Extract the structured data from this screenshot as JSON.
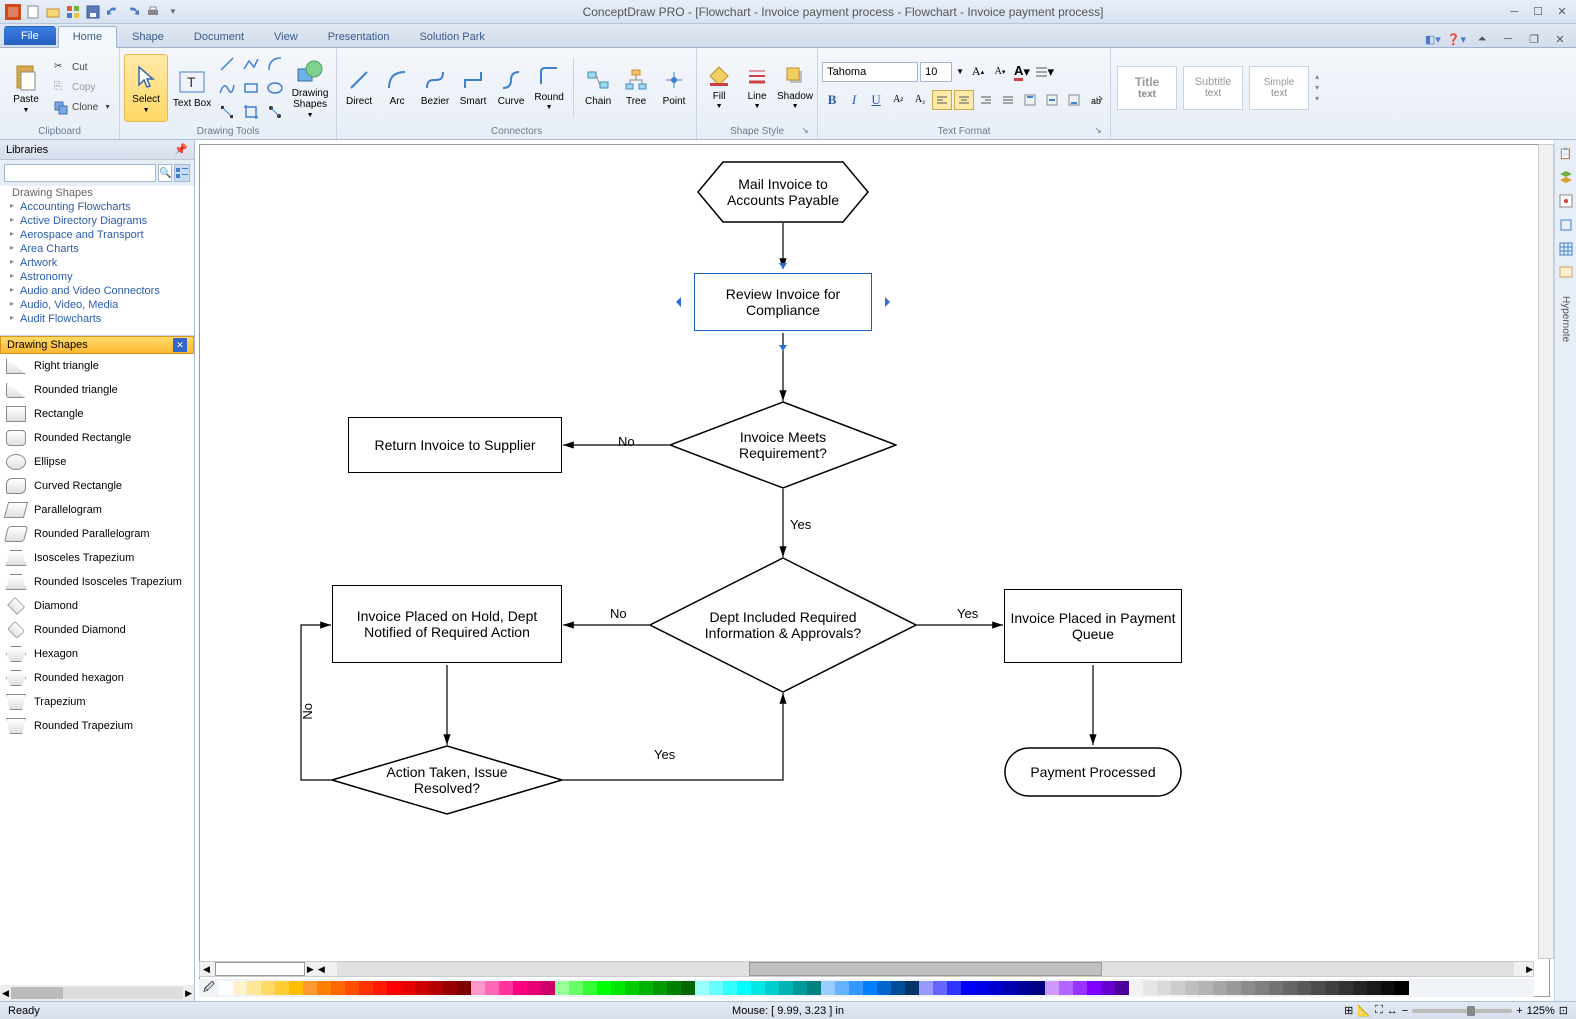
{
  "app": {
    "title": "ConceptDraw PRO - [Flowchart - Invoice payment process - Flowchart - Invoice payment process]"
  },
  "tabs": {
    "file": "File",
    "items": [
      "Home",
      "Shape",
      "Document",
      "View",
      "Presentation",
      "Solution Park"
    ],
    "active_index": 0
  },
  "ribbon": {
    "clipboard": {
      "paste": "Paste",
      "cut": "Cut",
      "copy": "Copy",
      "clone": "Clone",
      "label": "Clipboard"
    },
    "drawing_tools": {
      "select": "Select",
      "textbox": "Text Box",
      "drawing_shapes": "Drawing Shapes",
      "label": "Drawing Tools"
    },
    "connectors": {
      "direct": "Direct",
      "arc": "Arc",
      "bezier": "Bezier",
      "smart": "Smart",
      "curve": "Curve",
      "round": "Round",
      "chain": "Chain",
      "tree": "Tree",
      "point": "Point",
      "label": "Connectors"
    },
    "shape_style": {
      "fill": "Fill",
      "line": "Line",
      "shadow": "Shadow",
      "label": "Shape Style"
    },
    "text_format": {
      "font": "Tahoma",
      "size": "10",
      "label": "Text Format"
    },
    "styles": {
      "title": "Title text",
      "subtitle": "Subtitle text",
      "simple": "Simple text"
    }
  },
  "libraries": {
    "header": "Libraries",
    "search_placeholder": "",
    "root": "Drawing Shapes",
    "items": [
      "Accounting Flowcharts",
      "Active Directory Diagrams",
      "Aerospace and Transport",
      "Area Charts",
      "Artwork",
      "Astronomy",
      "Audio and Video Connectors",
      "Audio, Video, Media",
      "Audit Flowcharts"
    ]
  },
  "stencil": {
    "header": "Drawing Shapes",
    "shapes": [
      "Right triangle",
      "Rounded triangle",
      "Rectangle",
      "Rounded Rectangle",
      "Ellipse",
      "Curved Rectangle",
      "Parallelogram",
      "Rounded Parallelogram",
      "Isosceles Trapezium",
      "Rounded Isosceles Trapezium",
      "Diamond",
      "Rounded Diamond",
      "Hexagon",
      "Rounded hexagon",
      "Trapezium",
      "Rounded Trapezium"
    ]
  },
  "flowchart": {
    "mail": "Mail Invoice to Accounts Payable",
    "review": "Review Invoice for Compliance",
    "return": "Return Invoice to Supplier",
    "meets": "Invoice Meets Requirement?",
    "hold": "Invoice Placed on Hold, Dept Notified of Required Action",
    "dept": "Dept Included Required Information & Approvals?",
    "queue": "Invoice Placed in Payment Queue",
    "action": "Action Taken, Issue Resolved?",
    "payment": "Payment Processed",
    "no": "No",
    "yes": "Yes"
  },
  "statusbar": {
    "ready": "Ready",
    "mouse": "Mouse: [ 9.99, 3.23 ] in",
    "zoom": "125%"
  },
  "colors": [
    "#ffffff",
    "#fff2cc",
    "#ffe699",
    "#ffd966",
    "#ffcc33",
    "#ffbf00",
    "#ff9933",
    "#ff8000",
    "#ff6600",
    "#ff4d00",
    "#ff3300",
    "#ff1a00",
    "#ff0000",
    "#e60000",
    "#cc0000",
    "#b30000",
    "#990000",
    "#800000",
    "#ff99cc",
    "#ff66b3",
    "#ff3399",
    "#ff0080",
    "#e60073",
    "#cc0066",
    "#99ff99",
    "#66ff66",
    "#33ff33",
    "#00ff00",
    "#00e600",
    "#00cc00",
    "#00b300",
    "#009900",
    "#008000",
    "#006600",
    "#99ffff",
    "#66ffff",
    "#33ffff",
    "#00ffff",
    "#00e6e6",
    "#00cccc",
    "#00b3b3",
    "#009999",
    "#008080",
    "#99ccff",
    "#66b3ff",
    "#3399ff",
    "#0080ff",
    "#0066cc",
    "#004d99",
    "#003366",
    "#9999ff",
    "#6666ff",
    "#3333ff",
    "#0000ff",
    "#0000e6",
    "#0000cc",
    "#0000b3",
    "#000099",
    "#000080",
    "#cc99ff",
    "#b366ff",
    "#9933ff",
    "#8000ff",
    "#6600cc",
    "#4d0099",
    "#f2f2f2",
    "#e6e6e6",
    "#d9d9d9",
    "#cccccc",
    "#bfbfbf",
    "#b3b3b3",
    "#a6a6a6",
    "#999999",
    "#8c8c8c",
    "#808080",
    "#737373",
    "#666666",
    "#595959",
    "#4d4d4d",
    "#404040",
    "#333333",
    "#262626",
    "#1a1a1a",
    "#0d0d0d",
    "#000000"
  ]
}
